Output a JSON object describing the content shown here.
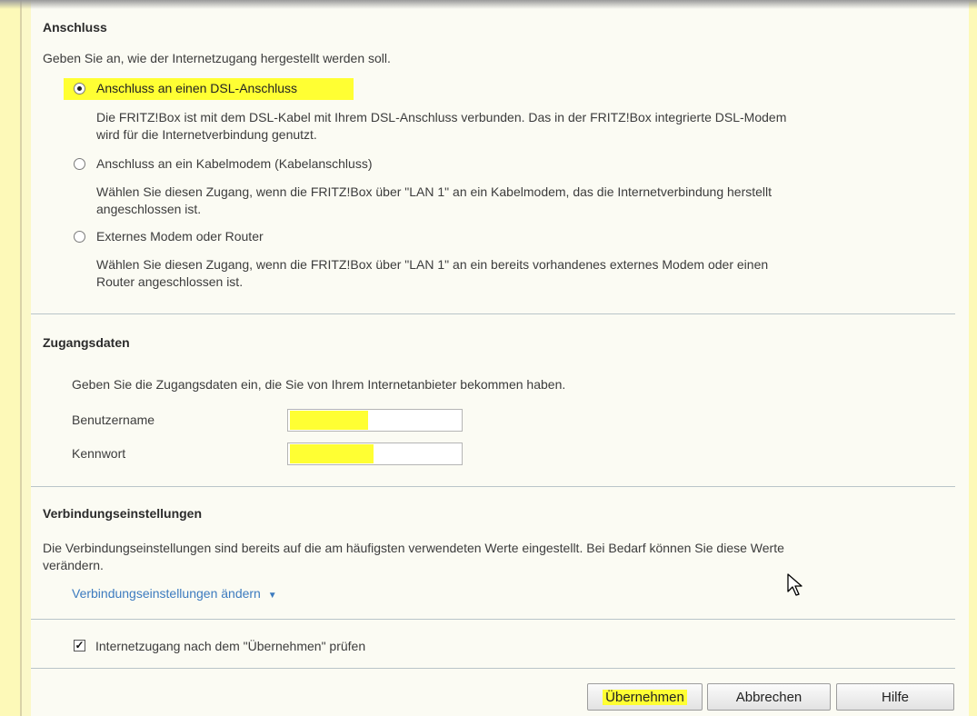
{
  "anschluss": {
    "heading": "Anschluss",
    "intro": "Geben Sie an, wie der Internetzugang hergestellt werden soll.",
    "options": [
      {
        "label": "Anschluss an einen DSL-Anschluss",
        "selected": true,
        "description_line1": "Die FRITZ!Box ist mit dem DSL-Kabel mit Ihrem DSL-Anschluss verbunden. Das in der FRITZ!Box integrierte DSL-Modem",
        "description_line2": "wird für die Internetverbindung genutzt."
      },
      {
        "label": "Anschluss an ein Kabelmodem (Kabelanschluss)",
        "selected": false,
        "description_line1": "Wählen Sie diesen Zugang, wenn die FRITZ!Box über \"LAN 1\" an ein Kabelmodem, das die Internetverbindung herstellt",
        "description_line2": "angeschlossen ist."
      },
      {
        "label": "Externes Modem oder Router",
        "selected": false,
        "description_line1": "Wählen Sie diesen Zugang, wenn die FRITZ!Box über \"LAN 1\" an ein bereits vorhandenes externes Modem oder einen",
        "description_line2": "Router angeschlossen ist."
      }
    ]
  },
  "zugangsdaten": {
    "heading": "Zugangsdaten",
    "intro": "Geben Sie die Zugangsdaten ein, die Sie von Ihrem Internetanbieter bekommen haben.",
    "username_label": "Benutzername",
    "username_value": "",
    "password_label": "Kennwort",
    "password_value": ""
  },
  "verbindung": {
    "heading": "Verbindungseinstellungen",
    "intro_line1": "Die Verbindungseinstellungen sind bereits auf die am häufigsten verwendeten Werte eingestellt. Bei Bedarf können Sie diese Werte",
    "intro_line2": "verändern.",
    "link_label": "Verbindungseinstellungen ändern",
    "link_arrow": "▼"
  },
  "check": {
    "label": "Internetzugang nach dem \"Übernehmen\" prüfen",
    "checked": true
  },
  "buttons": {
    "apply": "Übernehmen",
    "cancel": "Abbrechen",
    "help": "Hilfe"
  },
  "colors": {
    "highlight": "#ffff33",
    "link": "#3d7bbf",
    "background_rail": "#fdf9b8"
  }
}
